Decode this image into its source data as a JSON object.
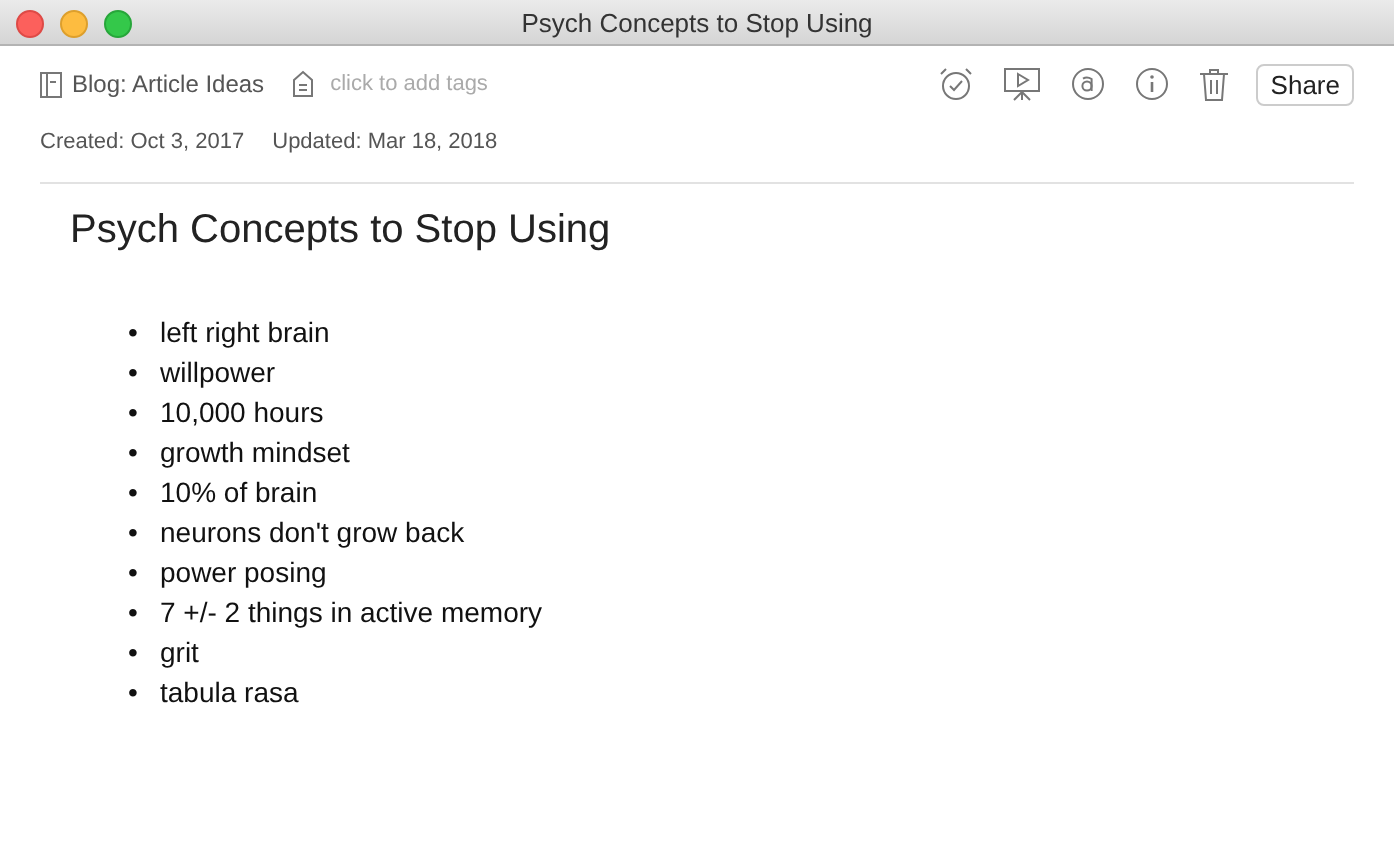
{
  "window": {
    "title": "Psych Concepts to Stop Using"
  },
  "toolbar": {
    "notebook": "Blog: Article Ideas",
    "tags_placeholder": "click to add tags",
    "share": "Share"
  },
  "meta": {
    "created": "Created: Oct 3, 2017",
    "updated": "Updated: Mar 18, 2018"
  },
  "note": {
    "title": "Psych Concepts to Stop Using",
    "items": [
      {
        "marker": "•",
        "text": "left right brain"
      },
      {
        "marker": "•",
        "text": "willpower"
      },
      {
        "marker": "•",
        "text": "10,000 hours"
      },
      {
        "marker": "•",
        "text": "growth mindset"
      },
      {
        "marker": "•",
        "text": "10% of brain"
      },
      {
        "marker": "•",
        "text": "neurons don't grow back"
      },
      {
        "marker": "•",
        "text": "power posing"
      },
      {
        "marker": "•",
        "text": "7 +/- 2 things in active memory"
      },
      {
        "marker": "•",
        "text": "grit"
      },
      {
        "marker": "•",
        "text": "tabula rasa"
      }
    ]
  }
}
